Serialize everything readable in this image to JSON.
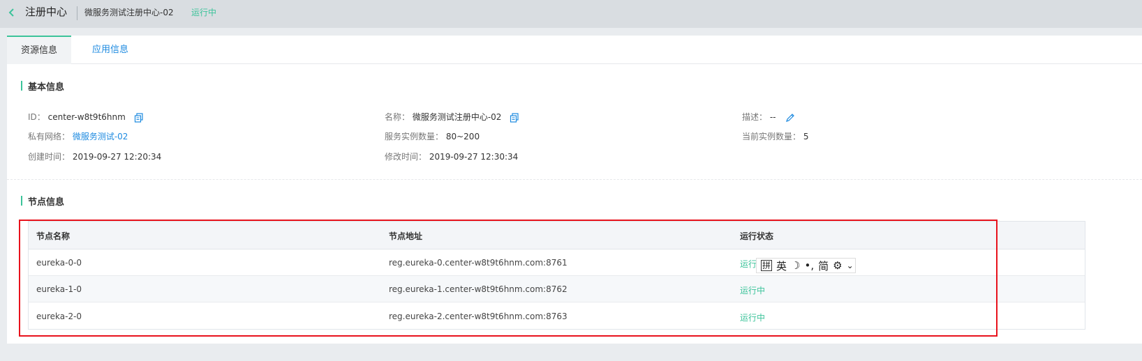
{
  "header": {
    "back_icon": "chevron-left-icon",
    "title": "注册中心",
    "subtitle": "微服务测试注册中心-02",
    "status": "运行中"
  },
  "tabs": [
    {
      "label": "资源信息",
      "active": true
    },
    {
      "label": "应用信息",
      "active": false
    }
  ],
  "basic": {
    "section_title": "基本信息",
    "id_label": "ID：",
    "id_value": "center-w8t9t6hnm",
    "name_label": "名称：",
    "name_value": "微服务测试注册中心-02",
    "desc_label": "描述：",
    "desc_value": "--",
    "vpc_label": "私有网络：",
    "vpc_value": "微服务测试-02",
    "instances_label": "服务实例数量：",
    "instances_value": "80~200",
    "current_label": "当前实例数量：",
    "current_value": "5",
    "created_label": "创建时间：",
    "created_value": "2019-09-27 12:20:34",
    "modified_label": "修改时间：",
    "modified_value": "2019-09-27 12:30:34"
  },
  "nodes": {
    "section_title": "节点信息",
    "columns": [
      "节点名称",
      "节点地址",
      "运行状态"
    ],
    "rows": [
      {
        "name": "eureka-0-0",
        "address": "reg.eureka-0.center-w8t9t6hnm.com:8761",
        "status": "运行"
      },
      {
        "name": "eureka-1-0",
        "address": "reg.eureka-1.center-w8t9t6hnm.com:8762",
        "status": "运行中"
      },
      {
        "name": "eureka-2-0",
        "address": "reg.eureka-2.center-w8t9t6hnm.com:8763",
        "status": "运行中"
      }
    ]
  },
  "ime": {
    "items": [
      "拼",
      "英",
      "☽",
      "•,",
      "简",
      "⚙",
      "⌄"
    ]
  },
  "colors": {
    "accent": "#3cc39a",
    "link": "#1d8ae0",
    "highlight": "#e8121c"
  }
}
